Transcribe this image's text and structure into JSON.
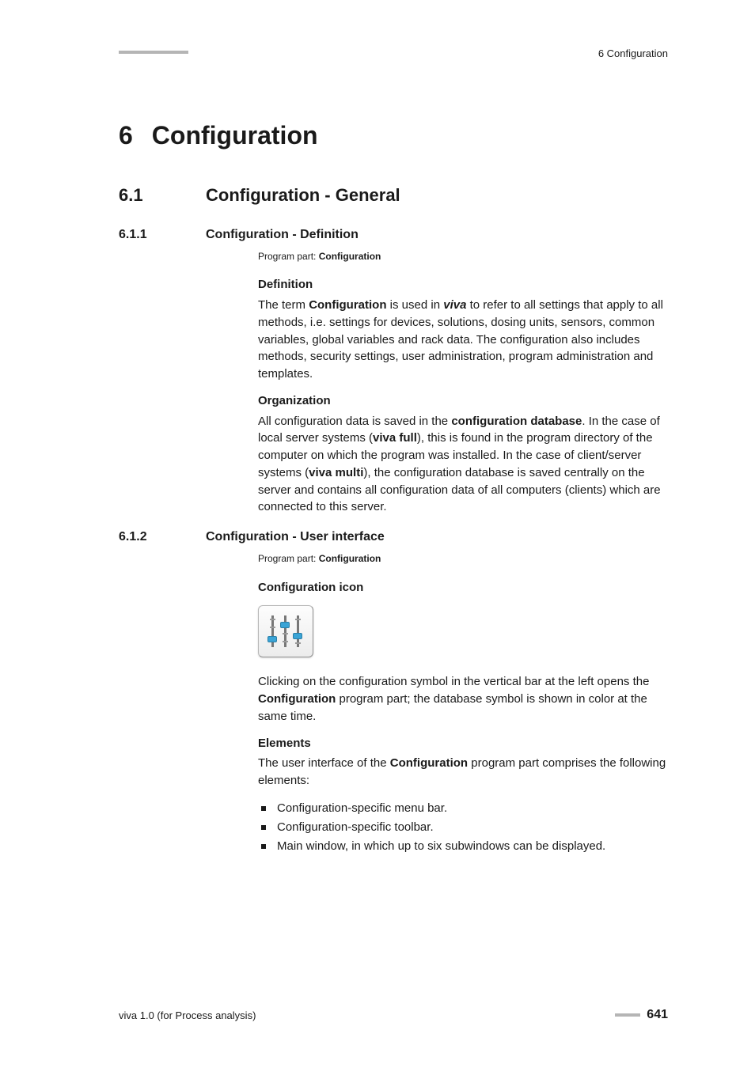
{
  "header": {
    "right_label": "6 Configuration"
  },
  "chapter": {
    "num": "6",
    "title": "Configuration"
  },
  "section": {
    "num": "6.1",
    "title": "Configuration - General"
  },
  "subsections": [
    {
      "num": "6.1.1",
      "title": "Configuration - Definition",
      "program_part_prefix": "Program part: ",
      "program_part_value": "Configuration",
      "blocks": [
        {
          "head": "Definition",
          "html": "The term <b>Configuration</b> is used in <em class='bi'>viva</em> to refer to all settings that apply to all methods, i.e. settings for devices, solutions, dosing units, sensors, common variables, global variables and rack data. The configuration also includes methods, security settings, user administration, program administration and templates."
        },
        {
          "head": "Organization",
          "html": "All configuration data is saved in the <b>configuration database</b>. In the case of local server systems (<b>viva full</b>), this is found in the program directory of the computer on which the program was installed. In the case of client/server systems (<b>viva multi</b>), the configuration database is saved centrally on the server and contains all configuration data of all computers (clients) which are connected to this server."
        }
      ]
    },
    {
      "num": "6.1.2",
      "title": "Configuration - User interface",
      "program_part_prefix": "Program part: ",
      "program_part_value": "Configuration",
      "blocks": [
        {
          "head": "Configuration icon",
          "icon": true,
          "html": "Clicking on the configuration symbol in the vertical bar at the left opens the <b>Configuration</b> program part; the database symbol is shown in color at the same time."
        },
        {
          "head": "Elements",
          "html": "The user interface of the <b>Configuration</b> program part comprises the following elements:",
          "bullets": [
            "Configuration-specific menu bar.",
            "Configuration-specific toolbar.",
            "Main window, in which up to six subwindows can be displayed."
          ]
        }
      ]
    }
  ],
  "footer": {
    "left": "viva 1.0 (for Process analysis)",
    "page": "641"
  }
}
